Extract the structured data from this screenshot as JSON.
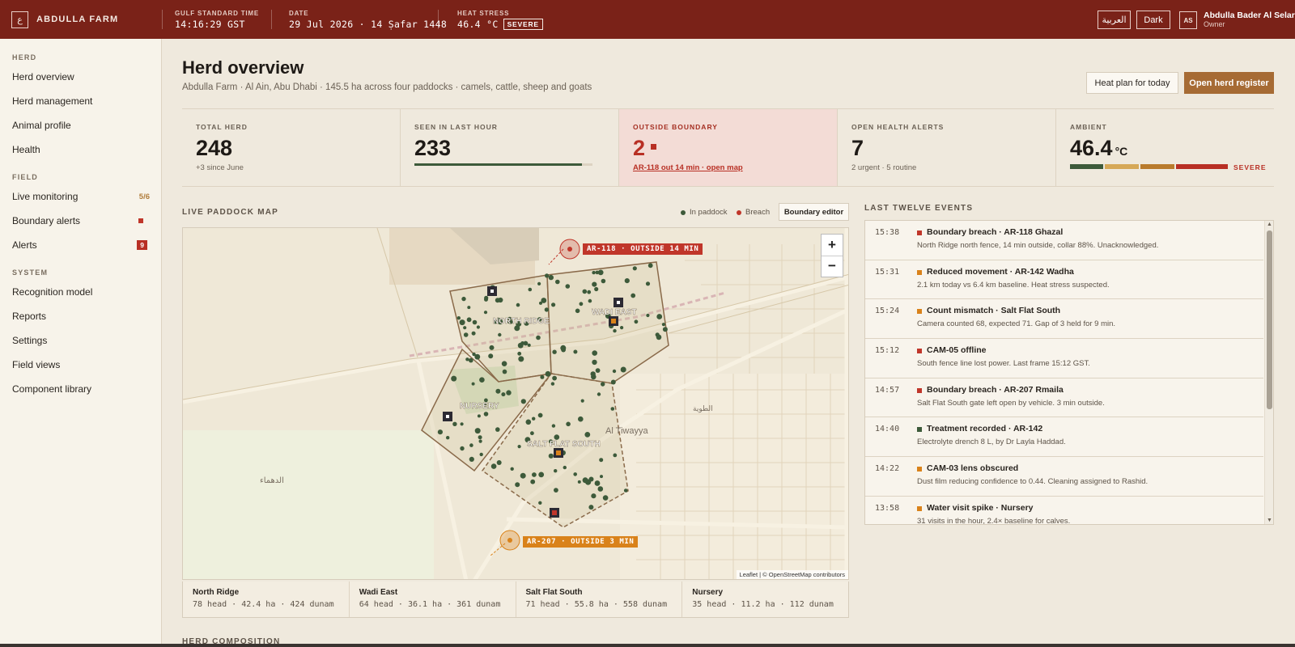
{
  "topbar": {
    "logo_glyph": "ع",
    "farm_name": "ABDULLA FARM",
    "time_label": "GULF STANDARD TIME",
    "time_value": "14:16:29 GST",
    "date_label": "DATE",
    "date_value": "29 Jul 2026 · 14 Ṣafar 1448",
    "heat_label": "HEAT STRESS",
    "heat_value": "46.4 °C",
    "heat_badge": "SEVERE",
    "lang_button": "العربية",
    "theme_button": "Dark",
    "user_initials": "AS",
    "user_name": "Abdulla Bader Al Selari",
    "user_role": "Owner"
  },
  "sidebar": {
    "sections": [
      {
        "title": "HERD",
        "items": [
          {
            "label": "Herd overview"
          },
          {
            "label": "Herd management"
          },
          {
            "label": "Animal profile"
          },
          {
            "label": "Health"
          }
        ]
      },
      {
        "title": "FIELD",
        "items": [
          {
            "label": "Live monitoring",
            "count": "5/6"
          },
          {
            "label": "Boundary alerts"
          },
          {
            "label": "Alerts",
            "badge": "9"
          }
        ]
      },
      {
        "title": "SYSTEM",
        "items": [
          {
            "label": "Recognition model"
          },
          {
            "label": "Reports"
          },
          {
            "label": "Settings"
          },
          {
            "label": "Field views"
          },
          {
            "label": "Component library"
          }
        ]
      }
    ]
  },
  "header": {
    "title": "Herd overview",
    "subtitle": "Abdulla Farm · Al Ain, Abu Dhabi · 145.5 ha across four paddocks · camels, cattle, sheep and goats",
    "heat_plan_button": "Heat plan for today",
    "register_button": "Open herd register"
  },
  "stats": {
    "total": {
      "label": "TOTAL HERD",
      "value": "248",
      "sub": "+3 since June"
    },
    "seen": {
      "label": "SEEN IN LAST HOUR",
      "value": "233",
      "fraction": 0.94
    },
    "outside": {
      "label": "OUTSIDE BOUNDARY",
      "value": "2",
      "link": "AR-118 out 14 min · open map"
    },
    "health": {
      "label": "OPEN HEALTH ALERTS",
      "value": "7",
      "sub": "2 urgent · 5 routine"
    },
    "ambient": {
      "label": "AMBIENT",
      "value": "46.4",
      "unit": "°C",
      "level": "SEVERE"
    }
  },
  "map": {
    "section_label": "LIVE PADDOCK MAP",
    "legend_in": "In paddock",
    "legend_breach": "Breach",
    "editor_button": "Boundary editor",
    "zoom_in": "+",
    "zoom_out": "−",
    "attribution": "Leaflet | © OpenStreetMap contributors",
    "alert_1": "AR-118 · OUTSIDE 14 MIN",
    "alert_2": "AR-207 · OUTSIDE 3 MIN",
    "area_labels": {
      "north": "NORTH RIDGE",
      "wadi": "WADI EAST",
      "nursery": "NURSERY",
      "salt": "SALT FLAT SOUTH",
      "tiwayya": "Al Tiwayya",
      "dahma": "الدهماء",
      "tawiya_ar": "الطوية"
    },
    "colors": {
      "in_paddock": "#3d5a3a",
      "breach": "#c0362a",
      "warning": "#d9821a",
      "boundary": "#8a6a4a"
    }
  },
  "paddocks": [
    {
      "name": "North Ridge",
      "info": "78 head · 42.4 ha · 424 dunam"
    },
    {
      "name": "Wadi East",
      "info": "64 head · 36.1 ha · 361 dunam"
    },
    {
      "name": "Salt Flat South",
      "info": "71 head · 55.8 ha · 558 dunam"
    },
    {
      "name": "Nursery",
      "info": "35 head · 11.2 ha · 112 dunam"
    }
  ],
  "composition_label": "HERD COMPOSITION",
  "events": {
    "title": "LAST TWELVE EVENTS",
    "items": [
      {
        "time": "15:38",
        "title": "Boundary breach · AR-118 Ghazal",
        "desc": "North Ridge north fence, 14 min outside, collar 88%. Unacknowledged.",
        "color": "#c0362a"
      },
      {
        "time": "15:31",
        "title": "Reduced movement · AR-142 Wadha",
        "desc": "2.1 km today vs 6.4 km baseline. Heat stress suspected.",
        "color": "#d9821a"
      },
      {
        "time": "15:24",
        "title": "Count mismatch · Salt Flat South",
        "desc": "Camera counted 68, expected 71. Gap of 3 held for 9 min.",
        "color": "#d9821a"
      },
      {
        "time": "15:12",
        "title": "CAM-05 offline",
        "desc": "South fence line lost power. Last frame 15:12 GST.",
        "color": "#c0362a"
      },
      {
        "time": "14:57",
        "title": "Boundary breach · AR-207 Rmaila",
        "desc": "Salt Flat South gate left open by vehicle. 3 min outside.",
        "color": "#c0362a"
      },
      {
        "time": "14:40",
        "title": "Treatment recorded · AR-142",
        "desc": "Electrolyte drench 8 L, by Dr Layla Haddad.",
        "color": "#3d5a3a"
      },
      {
        "time": "14:22",
        "title": "CAM-03 lens obscured",
        "desc": "Dust film reducing confidence to 0.44. Cleaning assigned to Rashid.",
        "color": "#d9821a"
      },
      {
        "time": "13:58",
        "title": "Water visit spike · Nursery",
        "desc": "31 visits in the hour, 2.4× baseline for calves.",
        "color": "#d9821a"
      }
    ]
  }
}
